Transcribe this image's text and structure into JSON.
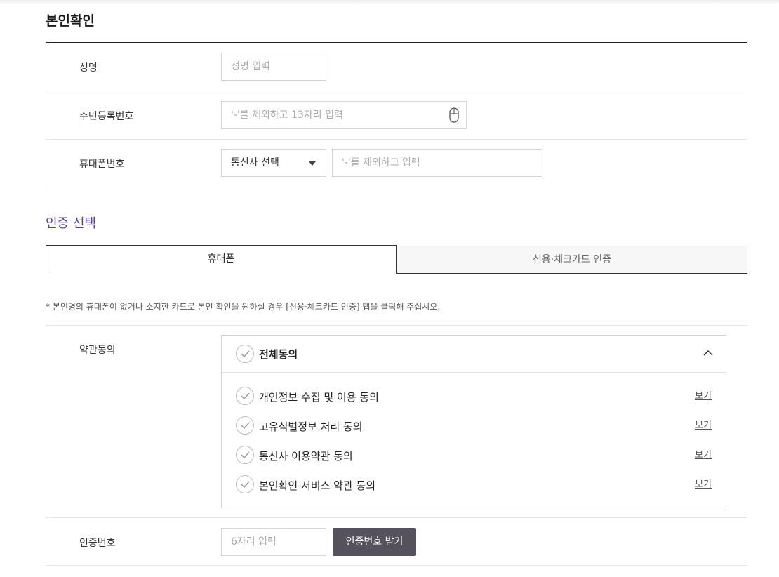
{
  "identity": {
    "title": "본인확인",
    "name": {
      "label": "성명",
      "placeholder": "성명 입력"
    },
    "rrn": {
      "label": "주민등록번호",
      "placeholder": "'-'를 제외하고 13자리 입력",
      "icon": "mouse-icon"
    },
    "phone": {
      "label": "휴대폰번호",
      "carrier_selected": "통신사 선택",
      "placeholder": "'-'를 제외하고 입력"
    }
  },
  "auth": {
    "title": "인증 선택",
    "tabs": [
      {
        "label": "휴대폰",
        "active": true
      },
      {
        "label": "신용·체크카드 인증",
        "active": false
      }
    ],
    "notice": "* 본인명의 휴대폰이 없거나 소지한 카드로 본인 확인을 원하실 경우 [신용·체크카드 인증] 탭을 클릭해 주십시오."
  },
  "terms": {
    "label": "약관동의",
    "all_label": "전체동의",
    "items": [
      {
        "label": "개인정보 수집 및 이용 동의",
        "view": "보기"
      },
      {
        "label": "고유식별정보 처리 동의",
        "view": "보기"
      },
      {
        "label": "통신사 이용약관 동의",
        "view": "보기"
      },
      {
        "label": "본인확인 서비스 약관 동의",
        "view": "보기"
      }
    ]
  },
  "verify": {
    "label": "인증번호",
    "placeholder": "6자리 입력",
    "button": "인증번호 받기"
  },
  "colors": {
    "accent": "#4f3f9e",
    "button_dark": "#55525e",
    "check_gray": "#9a9a9a"
  }
}
